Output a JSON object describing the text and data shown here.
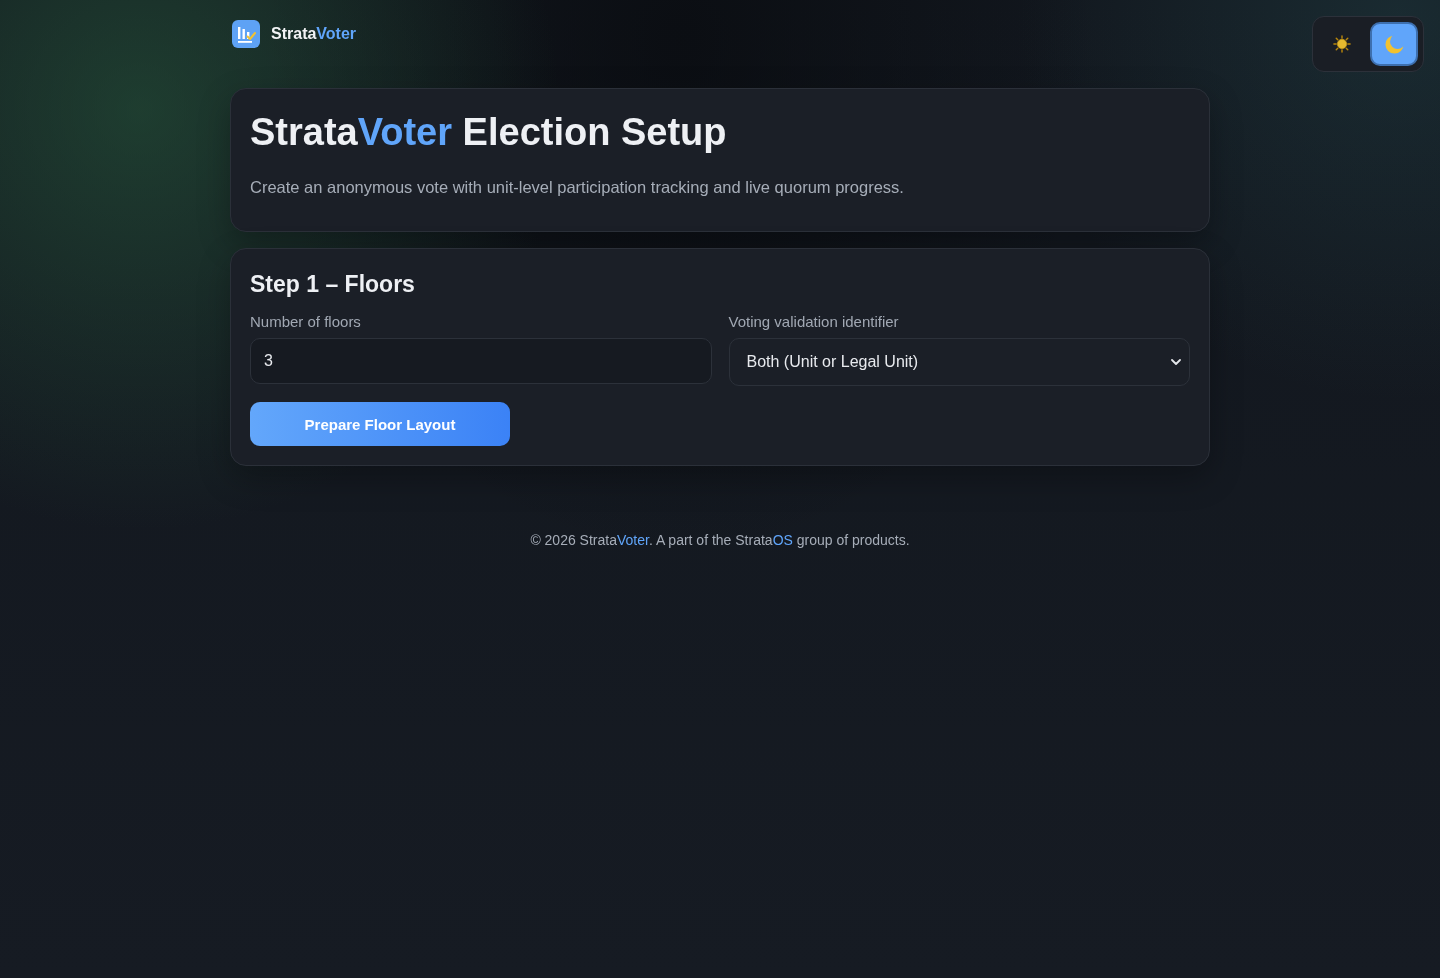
{
  "header": {
    "brand": [
      {
        "text": "Strata",
        "accent": false
      },
      {
        "text": "Voter",
        "accent": true
      }
    ]
  },
  "theme_toggle": [
    {
      "kind": "light",
      "selected": false
    },
    {
      "kind": "dark",
      "selected": true
    }
  ],
  "intro": {
    "title": [
      {
        "text": "Strata",
        "accent": false
      },
      {
        "text": "Voter",
        "accent": true
      },
      {
        "text": " Election Setup",
        "accent": false
      }
    ],
    "subtitle": "Create an anonymous vote with unit-level participation tracking and live quorum progress."
  },
  "step": {
    "title": "Step 1 – Floors",
    "fields": [
      {
        "kind": "number",
        "label": "Number of floors",
        "value": "3"
      },
      {
        "kind": "select",
        "label": "Voting validation identifier",
        "value": "Both (Unit or Legal Unit)"
      }
    ],
    "button": "Prepare Floor Layout"
  },
  "footer": [
    {
      "text": "© 2026 Strata",
      "accent": false
    },
    {
      "text": "Voter",
      "accent": true
    },
    {
      "text": ". A part of the Strata",
      "accent": false
    },
    {
      "text": "OS",
      "accent": true
    },
    {
      "text": " group of products.",
      "accent": false
    }
  ]
}
